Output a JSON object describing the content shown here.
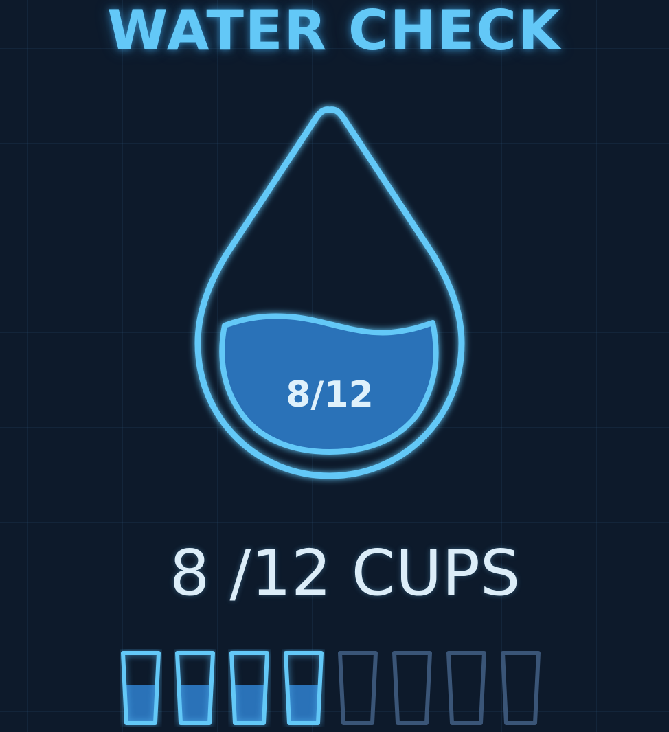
{
  "header": {
    "title": "WATER CHECK"
  },
  "drop": {
    "label": "8/12",
    "fill_fraction": 0.667,
    "icon": "water-drop-icon"
  },
  "summary": {
    "text": "8 /12 CUPS"
  },
  "progress": {
    "filled": 8,
    "total": 12,
    "cups": [
      {
        "state": "filled"
      },
      {
        "state": "filled"
      },
      {
        "state": "filled"
      },
      {
        "state": "filled"
      },
      {
        "state": "empty"
      },
      {
        "state": "empty"
      },
      {
        "state": "empty"
      },
      {
        "state": "empty"
      }
    ]
  },
  "colors": {
    "background": "#0d1a2b",
    "accent": "#63c8f7",
    "water_fill": "#2a72b8",
    "cup_empty_outline": "#3a5577",
    "text_light": "#dcedf8"
  }
}
